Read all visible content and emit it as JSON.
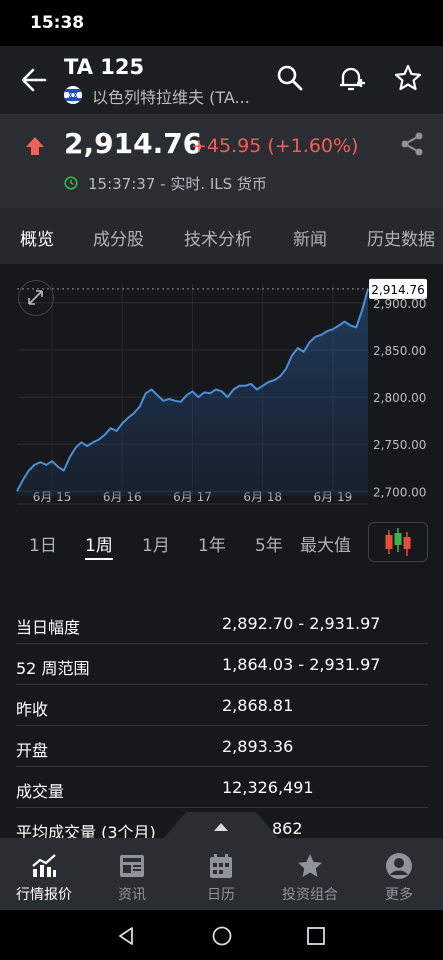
{
  "status_bar": {
    "time": "15:38"
  },
  "header": {
    "title": "TA 125",
    "subtitle": "以色列特拉维夫 (TA..."
  },
  "quote": {
    "price": "2,914.76",
    "change": "+45.95 (+1.60%)",
    "time_info": "15:37:37 - 实时. ILS 货币",
    "up_color": "#f05f5a"
  },
  "tabs": [
    "概览",
    "成分股",
    "技术分析",
    "新闻",
    "历史数据"
  ],
  "ranges": [
    "1日",
    "1周",
    "1月",
    "1年",
    "5年",
    "最大值"
  ],
  "chart_data": {
    "type": "area",
    "x_labels": [
      "6月 15",
      "6月 16",
      "6月 17",
      "6月 18",
      "6月 19"
    ],
    "y_ticks": [
      "2,900.00",
      "2,850.00",
      "2,800.00",
      "2,750.00",
      "2,700.00"
    ],
    "ylim": [
      2695,
      2920
    ],
    "last_value_label": "2,914.76",
    "values": [
      2700,
      2712,
      2722,
      2728,
      2731,
      2728,
      2732,
      2726,
      2722,
      2736,
      2746,
      2752,
      2748,
      2752,
      2755,
      2760,
      2767,
      2764,
      2772,
      2778,
      2783,
      2790,
      2804,
      2808,
      2802,
      2796,
      2798,
      2796,
      2795,
      2802,
      2806,
      2800,
      2805,
      2804,
      2808,
      2806,
      2800,
      2808,
      2812,
      2812,
      2814,
      2808,
      2812,
      2816,
      2818,
      2822,
      2830,
      2844,
      2852,
      2848,
      2858,
      2864,
      2866,
      2870,
      2872,
      2876,
      2880,
      2876,
      2874,
      2892,
      2914.76
    ],
    "line_color": "#4a90d9"
  },
  "stats": [
    {
      "label": "当日幅度",
      "value": "2,892.70 - 2,931.97"
    },
    {
      "label": "52 周范围",
      "value": "1,864.03 - 2,931.97"
    },
    {
      "label": "昨收",
      "value": "2,868.81"
    },
    {
      "label": "开盘",
      "value": "2,893.36"
    },
    {
      "label": "成交量",
      "value": "12,326,491"
    },
    {
      "label": "平均成交量 (3个月)",
      "value": "862"
    }
  ],
  "bottom_nav": [
    {
      "label": "行情报价",
      "icon": "chart-icon"
    },
    {
      "label": "资讯",
      "icon": "news-icon"
    },
    {
      "label": "日历",
      "icon": "calendar-icon"
    },
    {
      "label": "投资组合",
      "icon": "star-icon"
    },
    {
      "label": "更多",
      "icon": "user-icon"
    }
  ]
}
